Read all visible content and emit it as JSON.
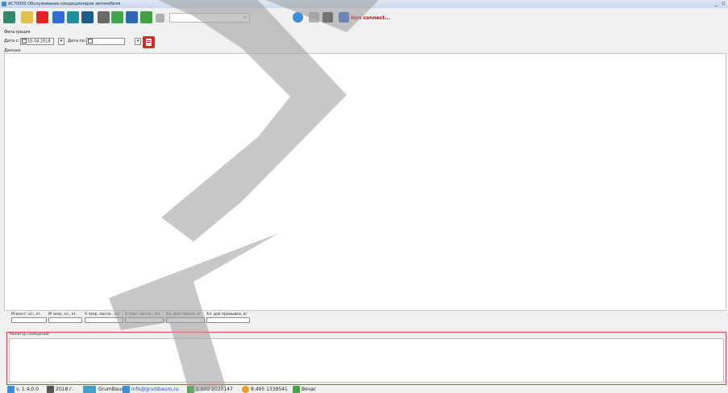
{
  "window": {
    "title": "AC7000S Обслуживание кондиционеров автомобиля",
    "minimize": "_",
    "restore": "▫"
  },
  "toolbar": {
    "buttons": [
      {
        "name": "device-icon",
        "color": "#2f8a6e"
      },
      {
        "name": "folder-icon",
        "color": "#e3c24a"
      },
      {
        "name": "stop-icon",
        "color": "#e02424"
      },
      {
        "name": "database-icon",
        "color": "#2a6fd6"
      },
      {
        "name": "table-icon",
        "color": "#1f8fa0"
      },
      {
        "name": "report-icon",
        "color": "#1b5f8c"
      },
      {
        "name": "camera-icon",
        "color": "#6a6a6a"
      },
      {
        "name": "export-icon",
        "color": "#3fa84a"
      },
      {
        "name": "save-icon",
        "color": "#2d6ab8"
      },
      {
        "name": "battery-icon",
        "color": "#3ca23c"
      },
      {
        "name": "info-icon",
        "color": "#b0b0b0"
      }
    ],
    "combo_value": "",
    "right_buttons": [
      {
        "name": "connect-icon",
        "color": "#3a8fd8"
      },
      {
        "name": "list-icon",
        "color": "#b0b0b0"
      },
      {
        "name": "pause-icon",
        "color": "#444444"
      },
      {
        "name": "power-icon",
        "color": "#2a72d0"
      }
    ],
    "connection_status": "Non connect...",
    "connection_color": "#e00000"
  },
  "filter": {
    "group_label": "Фильтрация",
    "date_from_label": "Дата с:",
    "date_from_value": "10.04.2018",
    "date_to_label": "Дата по:",
    "date_to_value": ""
  },
  "data_section": {
    "label": "Данные"
  },
  "fields": [
    {
      "label": "M восст. хл., кг."
    },
    {
      "label": "M запр. хл., кг."
    },
    {
      "label": "V запр. масла., мл"
    },
    {
      "label": "V слит. масла., мл"
    },
    {
      "label": "Хл. для поиска, кг"
    },
    {
      "label": "Хл. для промывки, кг"
    }
  ],
  "monitor": {
    "label": "Монитор сообщений"
  },
  "status": {
    "version": "v. 1.4.0.0",
    "year": "2018 г.",
    "brand": "GrumBaum",
    "email": "info@grumbaum.ru",
    "phone1": "8 800 2020147",
    "phone2": "8 495 1339541",
    "extra": "Вечас"
  }
}
